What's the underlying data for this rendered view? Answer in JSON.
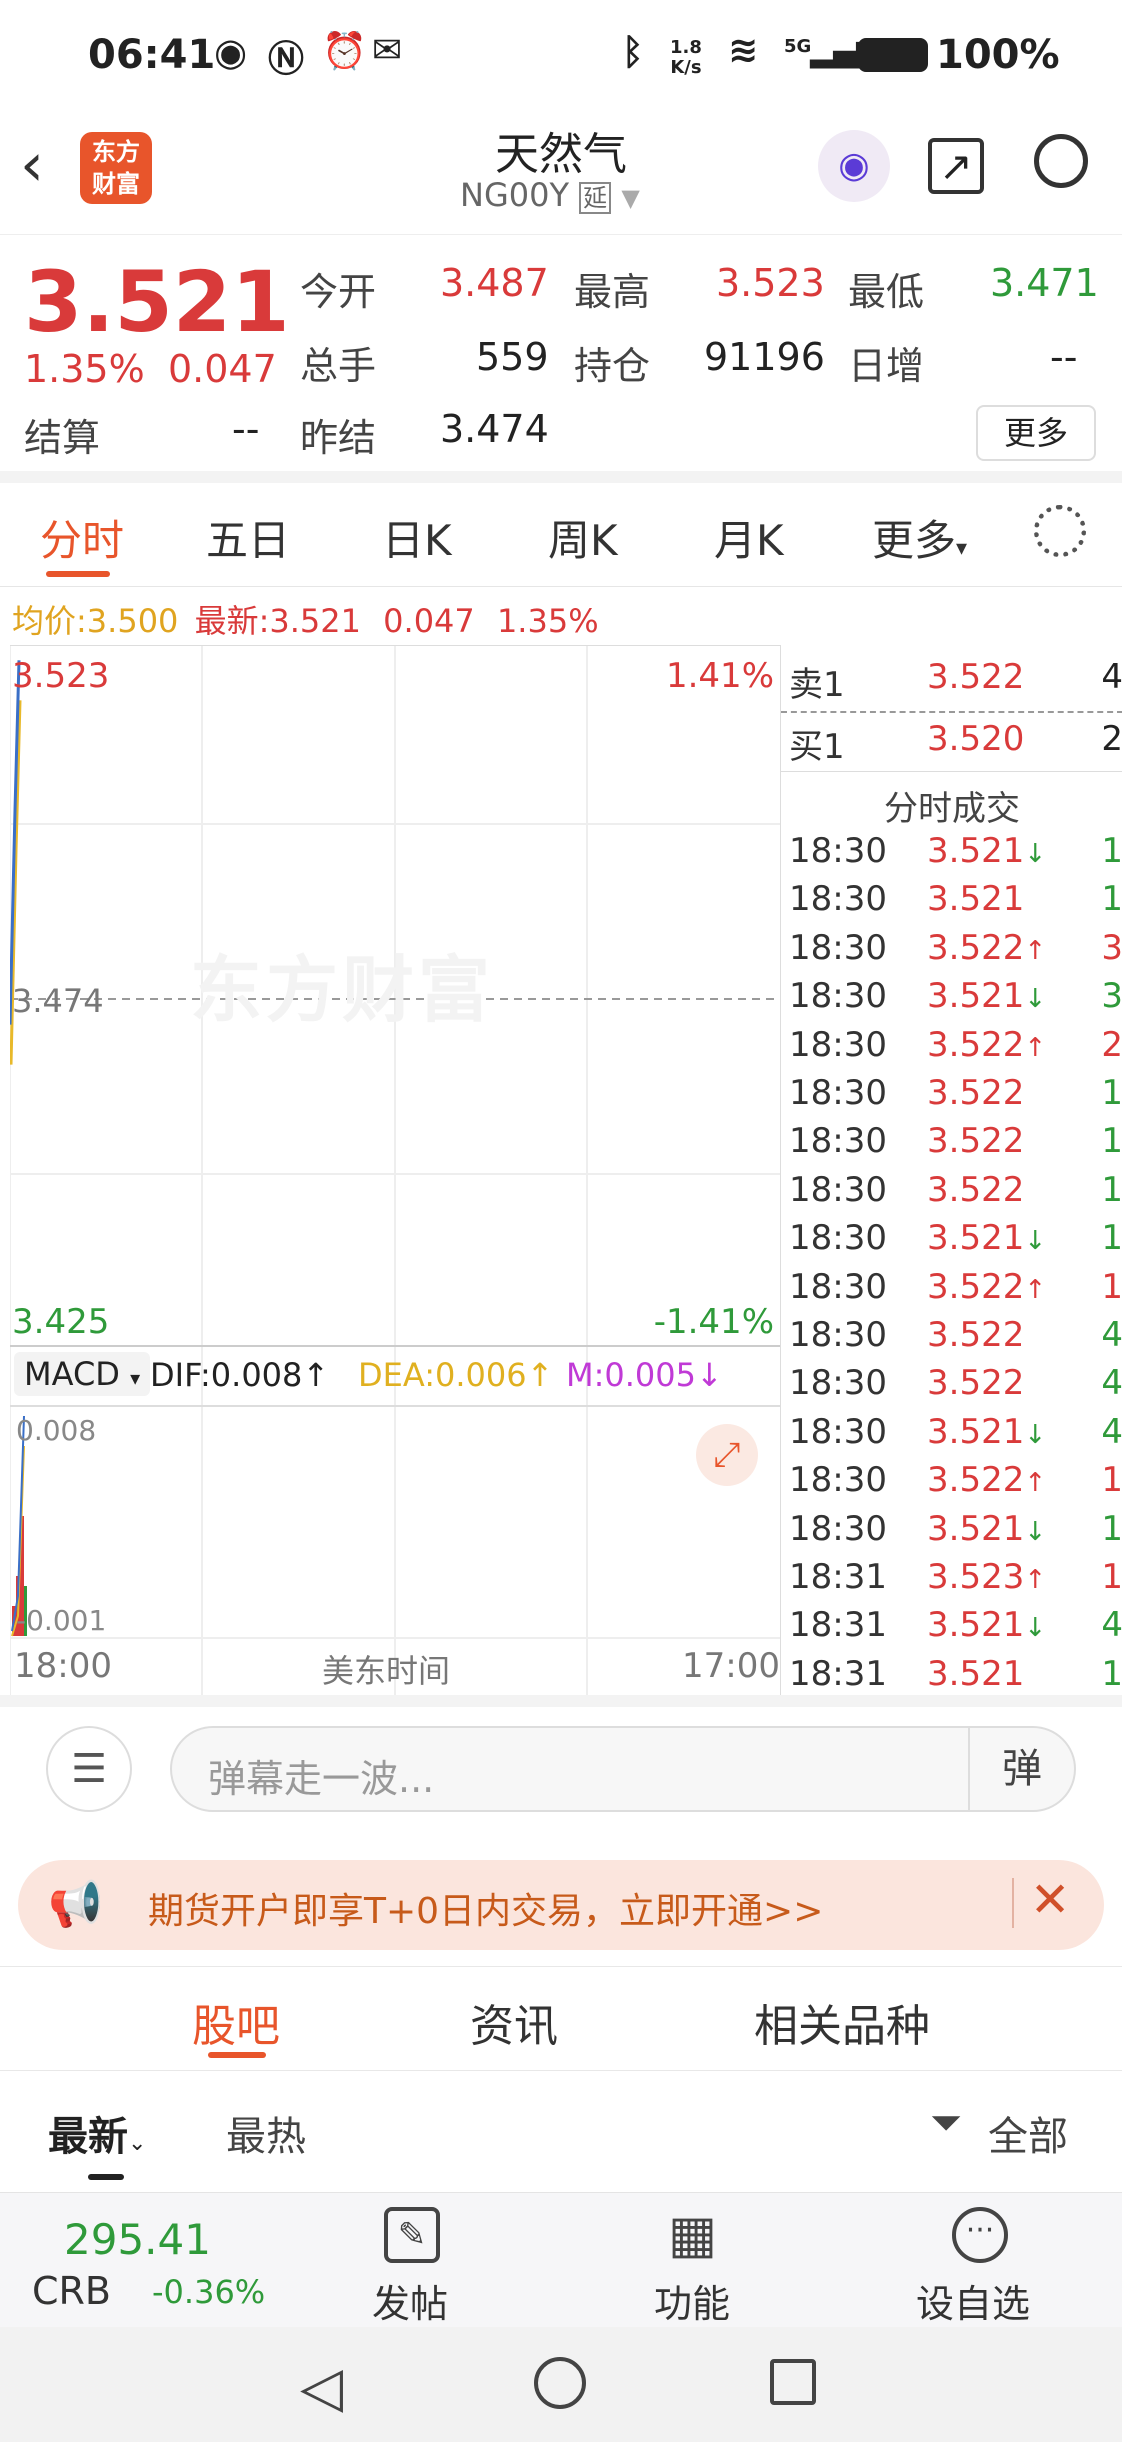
{
  "status_bar": {
    "time": "06:41",
    "net_speed_top": "1.8",
    "net_speed_bottom": "K/s",
    "signal": "5G",
    "battery": "100%"
  },
  "header": {
    "title": "天然气",
    "code": "NG00Y",
    "code_badge": "延",
    "logo_line1": "东方",
    "logo_line2": "财富"
  },
  "quote": {
    "price": "3.521",
    "change_pct": "1.35%",
    "change": "0.047",
    "fields": [
      {
        "label": "今开",
        "value": "3.487"
      },
      {
        "label": "最高",
        "value": "3.523"
      },
      {
        "label": "最低",
        "value": "3.471"
      },
      {
        "label": "总手",
        "value": "559"
      },
      {
        "label": "持仓",
        "value": "91196"
      },
      {
        "label": "日增",
        "value": "--"
      },
      {
        "label": "结算",
        "value": "--"
      },
      {
        "label": "昨结",
        "value": "3.474"
      }
    ],
    "more": "更多"
  },
  "tabs": [
    "分时",
    "五日",
    "日K",
    "周K",
    "月K",
    "更多"
  ],
  "info_line": {
    "avg_label": "均价:",
    "avg": "3.500",
    "latest_label": "最新:",
    "latest": "3.521",
    "chg": "0.047",
    "pct": "1.35%"
  },
  "chart": {
    "top_price": "3.523",
    "top_pct": "1.41%",
    "mid_price": "3.474",
    "bottom_price": "3.425",
    "bottom_pct": "-1.41%",
    "watermark": "东方财富",
    "macd_label": "MACD",
    "dif": "DIF:0.008",
    "dea": "DEA:0.006",
    "m": "M:0.005",
    "macd_top": "0.008",
    "macd_bottom": "-0.001",
    "x_start": "18:00",
    "x_mid": "美东时间",
    "x_end": "17:00"
  },
  "chart_data": {
    "type": "line",
    "x": [
      "18:00",
      "18:30",
      "18:31"
    ],
    "series": [
      {
        "values": [
          3.47,
          3.5,
          3.521
        ]
      }
    ],
    "ylim": [
      3.425,
      3.523
    ]
  },
  "orderbook": {
    "sell_label": "卖1",
    "sell_price": "3.522",
    "sell_qty": "4",
    "buy_label": "买1",
    "buy_price": "3.520",
    "buy_qty": "2",
    "trades_title": "分时成交",
    "trades": [
      {
        "t": "18:30",
        "p": "3.521",
        "a": "↓",
        "v": "1"
      },
      {
        "t": "18:30",
        "p": "3.521",
        "a": "",
        "v": "1"
      },
      {
        "t": "18:30",
        "p": "3.522",
        "a": "↑",
        "v": "3"
      },
      {
        "t": "18:30",
        "p": "3.521",
        "a": "↓",
        "v": "3"
      },
      {
        "t": "18:30",
        "p": "3.522",
        "a": "↑",
        "v": "2"
      },
      {
        "t": "18:30",
        "p": "3.522",
        "a": "",
        "v": "1"
      },
      {
        "t": "18:30",
        "p": "3.522",
        "a": "",
        "v": "1"
      },
      {
        "t": "18:30",
        "p": "3.522",
        "a": "",
        "v": "1"
      },
      {
        "t": "18:30",
        "p": "3.521",
        "a": "↓",
        "v": "1"
      },
      {
        "t": "18:30",
        "p": "3.522",
        "a": "↑",
        "v": "1"
      },
      {
        "t": "18:30",
        "p": "3.522",
        "a": "",
        "v": "4"
      },
      {
        "t": "18:30",
        "p": "3.522",
        "a": "",
        "v": "4"
      },
      {
        "t": "18:30",
        "p": "3.521",
        "a": "↓",
        "v": "4"
      },
      {
        "t": "18:30",
        "p": "3.522",
        "a": "↑",
        "v": "1"
      },
      {
        "t": "18:30",
        "p": "3.521",
        "a": "↓",
        "v": "1"
      },
      {
        "t": "18:31",
        "p": "3.523",
        "a": "↑",
        "v": "1"
      },
      {
        "t": "18:31",
        "p": "3.521",
        "a": "↓",
        "v": "4"
      },
      {
        "t": "18:31",
        "p": "3.521",
        "a": "",
        "v": "1"
      }
    ]
  },
  "danmu": {
    "placeholder": "弹幕走一波...",
    "button": "弹"
  },
  "banner": {
    "text": "期货开户即享T+0日内交易，立即开通>>"
  },
  "section_tabs": [
    "股吧",
    "资讯",
    "相关品种"
  ],
  "filter": {
    "latest": "最新",
    "hot": "最热",
    "all": "全部"
  },
  "bottom": {
    "index_value": "295.41",
    "index_name": "CRB",
    "index_pct": "-0.36%",
    "post": "发帖",
    "func": "功能",
    "watch": "设自选"
  }
}
